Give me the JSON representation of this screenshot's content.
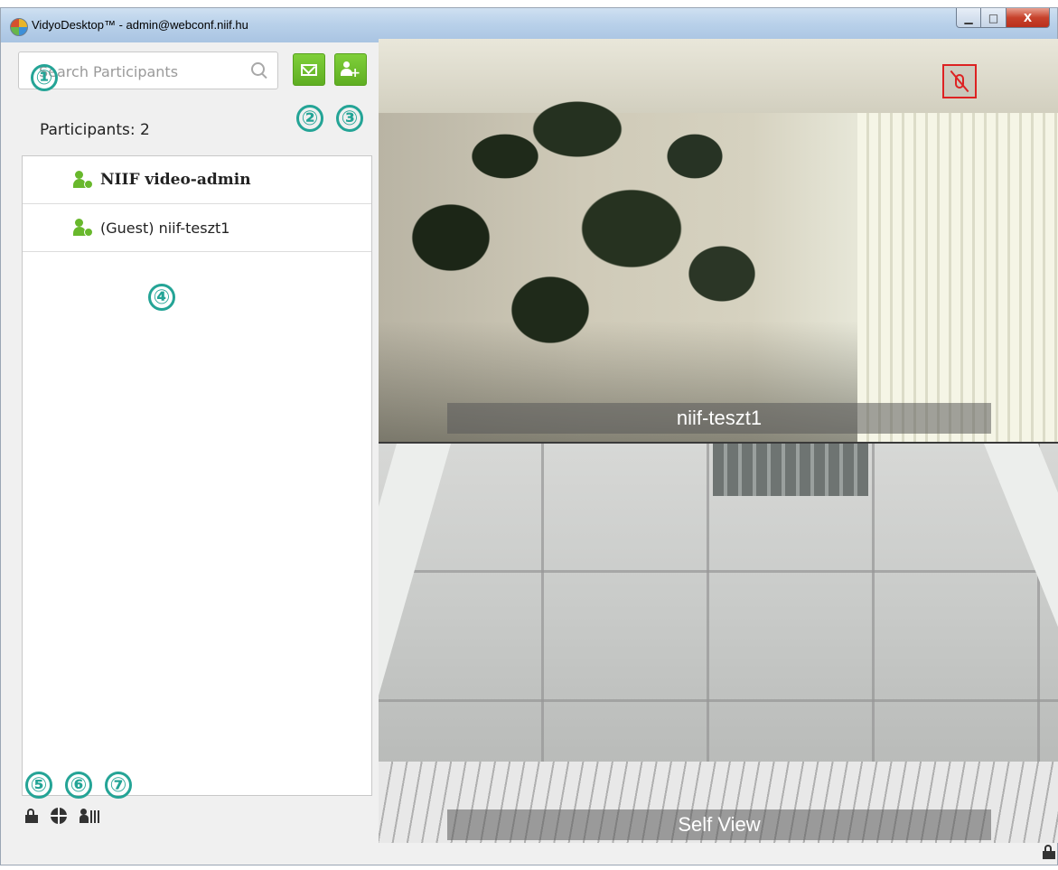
{
  "window": {
    "title": "VidyoDesktop™ - admin@webconf.niif.hu",
    "controls": {
      "minimize": "▁",
      "maximize": "□",
      "close": "X"
    }
  },
  "sidebar": {
    "search": {
      "placeholder": "Search Participants",
      "icon": "search-icon"
    },
    "invite_button_icon": "mail-send-icon",
    "add_participant_button_icon": "add-person-icon",
    "participants_label": "Participants: 2",
    "participants": [
      {
        "name": "NIIF video-admin",
        "bold": true,
        "icon": "person-check-icon"
      },
      {
        "name": "(Guest) niif-teszt1",
        "bold": false,
        "icon": "person-check-icon"
      }
    ],
    "bottom_icons": [
      "lock-open-icon",
      "globe-icon",
      "presenter-icon"
    ]
  },
  "callouts": [
    "①",
    "②",
    "③",
    "④",
    "⑤",
    "⑥",
    "⑦"
  ],
  "video": {
    "remote_caption": "niif-teszt1",
    "remote_muted": true,
    "self_caption": "Self View"
  },
  "colors": {
    "accent_green": "#68b82c",
    "callout_teal": "#24a496",
    "mute_red": "#dd2222"
  }
}
